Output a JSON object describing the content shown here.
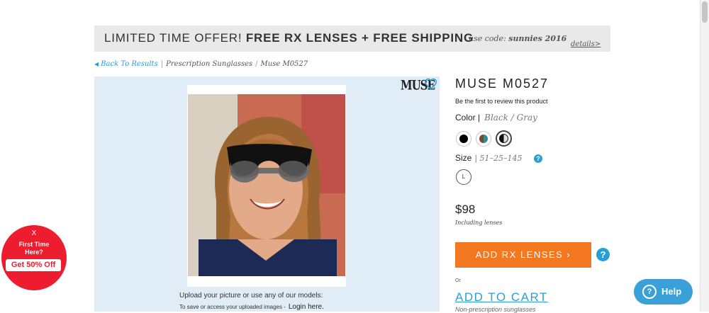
{
  "promo": {
    "text_part1": "LIMITED TIME OFFER! ",
    "text_part2": "FREE RX LENSES + FREE SHIPPING",
    "code_prefix": "use code: ",
    "code": "sunnies 2016",
    "details_link": "details>"
  },
  "breadcrumb": {
    "back": "Back To Results",
    "category": "Prescription Sunglasses",
    "current": "Muse M0527"
  },
  "viewer": {
    "brand_logo": "MUSE",
    "upload_text": "Upload your picture or use any of our models:",
    "save_text": "To save or access your uploaded images -",
    "login_link": "Login here."
  },
  "product": {
    "title": "MUSE M0527",
    "review_prompt": "Be the first to review this product",
    "color_label": "Color |",
    "color_value": "Black / Gray",
    "color_swatches": [
      {
        "name": "black",
        "color": "#000000"
      },
      {
        "name": "brown-teal",
        "color": "#6b4a2f"
      },
      {
        "name": "black-gray",
        "color": "#333333"
      }
    ],
    "size_label": "Size",
    "size_value": "| 51–25–145",
    "size_option": "L",
    "price": "$98",
    "price_note": "Including lenses",
    "add_rx_label": "ADD RX LENSES ›",
    "or_text": "Or",
    "add_cart_label": "ADD TO CART",
    "nonrx_note": "Non-prescription sunglasses"
  },
  "first_time_badge": {
    "close": "X",
    "line1": "First Time",
    "line2": "Here?",
    "offer": "Get 50% Off"
  },
  "help_button": {
    "label": "Help",
    "icon": "?"
  },
  "colors": {
    "accent_blue": "#2a9fd6",
    "cta_orange": "#f47721",
    "badge_red": "#ed1c2e"
  }
}
